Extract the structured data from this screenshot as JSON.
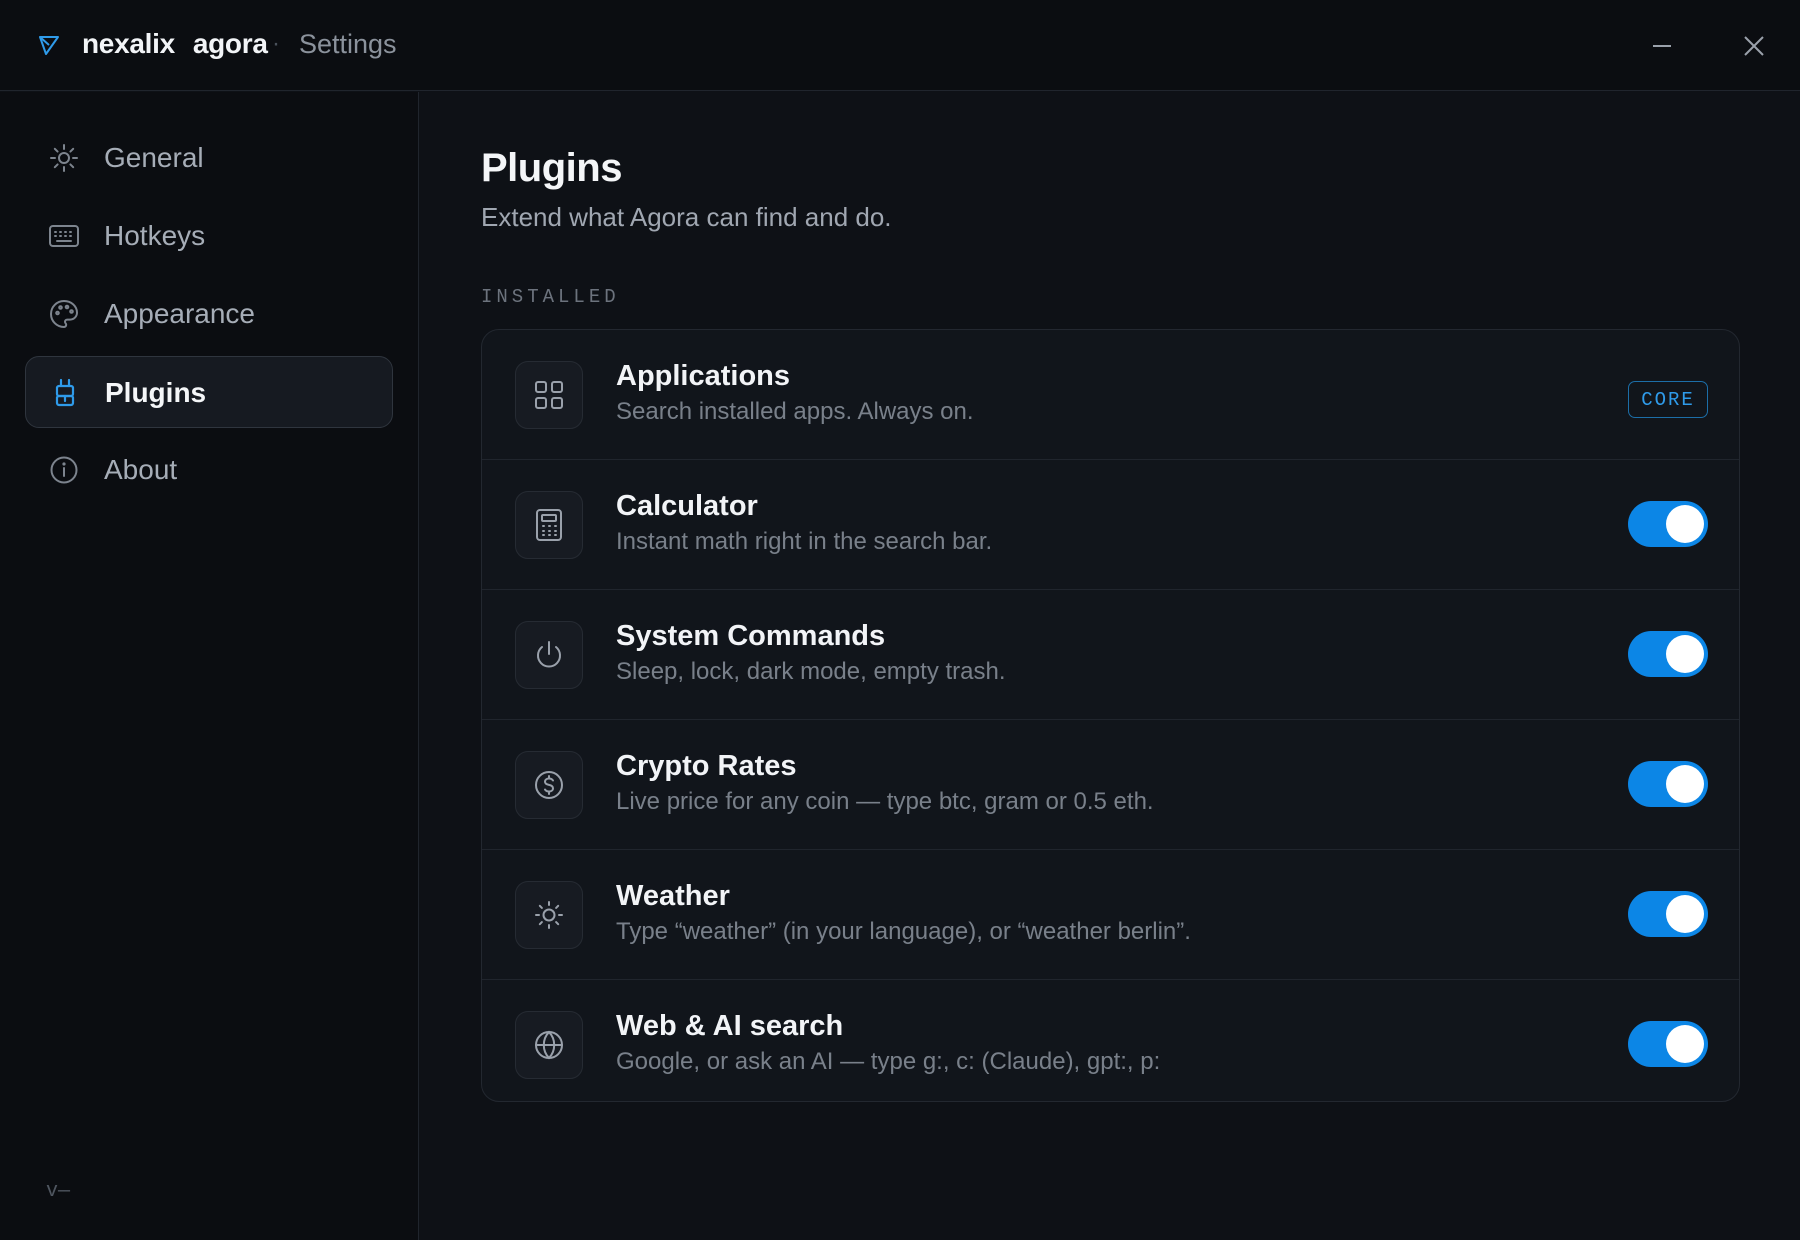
{
  "window": {
    "brand_first": "nexalix",
    "brand_second": "agora",
    "separator": "·",
    "page": "Settings",
    "logo_icon": "triangle-logo-icon",
    "minimize_icon": "minimize-icon",
    "close_icon": "close-icon"
  },
  "sidebar": {
    "items": [
      {
        "label": "General",
        "icon": "sun-gear-icon",
        "active": false
      },
      {
        "label": "Hotkeys",
        "icon": "keyboard-icon",
        "active": false
      },
      {
        "label": "Appearance",
        "icon": "palette-icon",
        "active": false
      },
      {
        "label": "Plugins",
        "icon": "plug-icon",
        "active": true
      },
      {
        "label": "About",
        "icon": "info-icon",
        "active": false
      }
    ],
    "version": "v—"
  },
  "main": {
    "title": "Plugins",
    "subtitle": "Extend what Agora can find and do.",
    "section_label": "INSTALLED",
    "plugins": [
      {
        "name": "Applications",
        "description": "Search installed apps. Always on.",
        "icon": "grid-icon",
        "badge": "CORE",
        "enabled": true
      },
      {
        "name": "Calculator",
        "description": "Instant math right in the search bar.",
        "icon": "calculator-icon",
        "enabled": true
      },
      {
        "name": "System Commands",
        "description": "Sleep, lock, dark mode, empty trash.",
        "icon": "power-icon",
        "enabled": true
      },
      {
        "name": "Crypto Rates",
        "description": "Live price for any coin — type btc, gram or 0.5 eth.",
        "icon": "dollar-coin-icon",
        "enabled": true
      },
      {
        "name": "Weather",
        "description": "Type “weather” (in your language), or “weather berlin”.",
        "icon": "sun-icon",
        "enabled": true
      },
      {
        "name": "Web & AI search",
        "description": "Google, or ask an AI — type g:, c: (Claude), gpt:, p:",
        "icon": "globe-icon",
        "enabled": true
      }
    ]
  },
  "colors": {
    "accent": "#0c86e6",
    "badge": "#2f9bea",
    "background": "#0e1116",
    "card": "#11151b"
  }
}
